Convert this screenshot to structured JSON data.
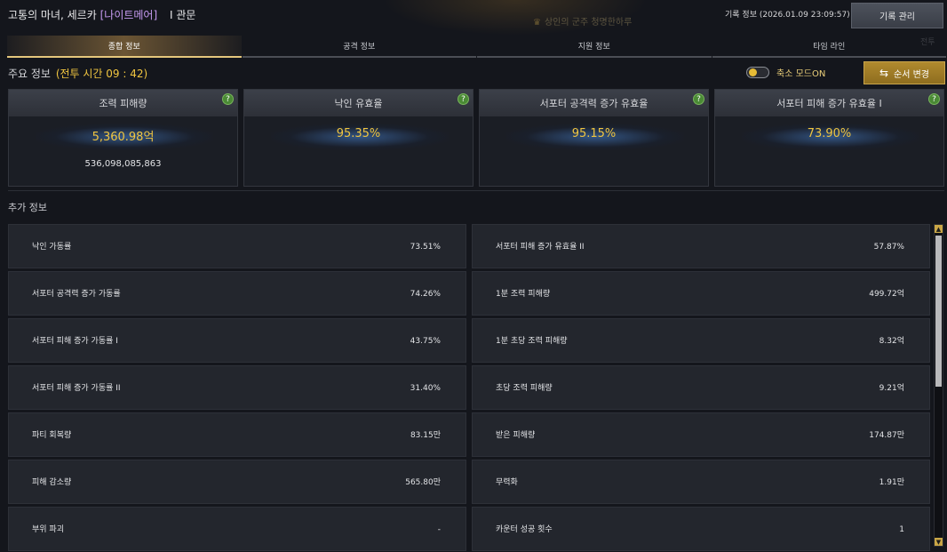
{
  "header": {
    "title": "고통의 마녀, 세르카",
    "difficulty_tag": "[나이트메어]",
    "stage": "I 관문",
    "ghost_center": "상인의 군주 청명한하루",
    "record_info": "기록 정보 (2026.01.09 23:09:57)",
    "manage_button": "기록 관리",
    "ghost_right": "전투"
  },
  "tabs": [
    {
      "label": "종합 정보",
      "active": true
    },
    {
      "label": "공격 정보",
      "active": false
    },
    {
      "label": "지원 정보",
      "active": false
    },
    {
      "label": "타임 라인",
      "active": false
    }
  ],
  "summary": {
    "label": "주요 정보",
    "battle_time": "(전투 시간 09 : 42)",
    "compact_mode_label": "축소 모드ON",
    "compact_mode_on": true,
    "order_button": "순서 변경"
  },
  "cards": [
    {
      "title": "조력 피해량",
      "value": "5,360.98억",
      "sub": "536,098,085,863"
    },
    {
      "title": "낙인 유효율",
      "value": "95.35%",
      "sub": ""
    },
    {
      "title": "서포터 공격력 증가 유효율",
      "value": "95.15%",
      "sub": ""
    },
    {
      "title": "서포터 피해 증가 유효율 I",
      "value": "73.90%",
      "sub": ""
    }
  ],
  "help_glyph": "?",
  "additional": {
    "label": "추가 정보",
    "left": [
      {
        "label": "낙인 가동률",
        "value": "73.51%"
      },
      {
        "label": "서포터 공격력 증가 가동률",
        "value": "74.26%"
      },
      {
        "label": "서포터 피해 증가 가동률 I",
        "value": "43.75%"
      },
      {
        "label": "서포터 피해 증가 가동률 II",
        "value": "31.40%"
      },
      {
        "label": "파티 회복량",
        "value": "83.15만"
      },
      {
        "label": "피해 감소량",
        "value": "565.80만"
      },
      {
        "label": "부위 파괴",
        "value": "-"
      }
    ],
    "right": [
      {
        "label": "서포터 피해 증가 유효율 II",
        "value": "57.87%"
      },
      {
        "label": "1분 조력 피해량",
        "value": "499.72억"
      },
      {
        "label": "1분 초당 조력 피해량",
        "value": "8.32억"
      },
      {
        "label": "초당 조력 피해량",
        "value": "9.21억"
      },
      {
        "label": "받은 피해량",
        "value": "174.87만"
      },
      {
        "label": "무력화",
        "value": "1.91만"
      },
      {
        "label": "카운터 성공 횟수",
        "value": "1"
      }
    ]
  },
  "colors": {
    "accent_gold": "#f0c540",
    "tag_purple": "#c79bf2",
    "help_green": "#4a8a35"
  },
  "scrollbar": {
    "up_glyph": "▲",
    "down_glyph": "▼"
  }
}
